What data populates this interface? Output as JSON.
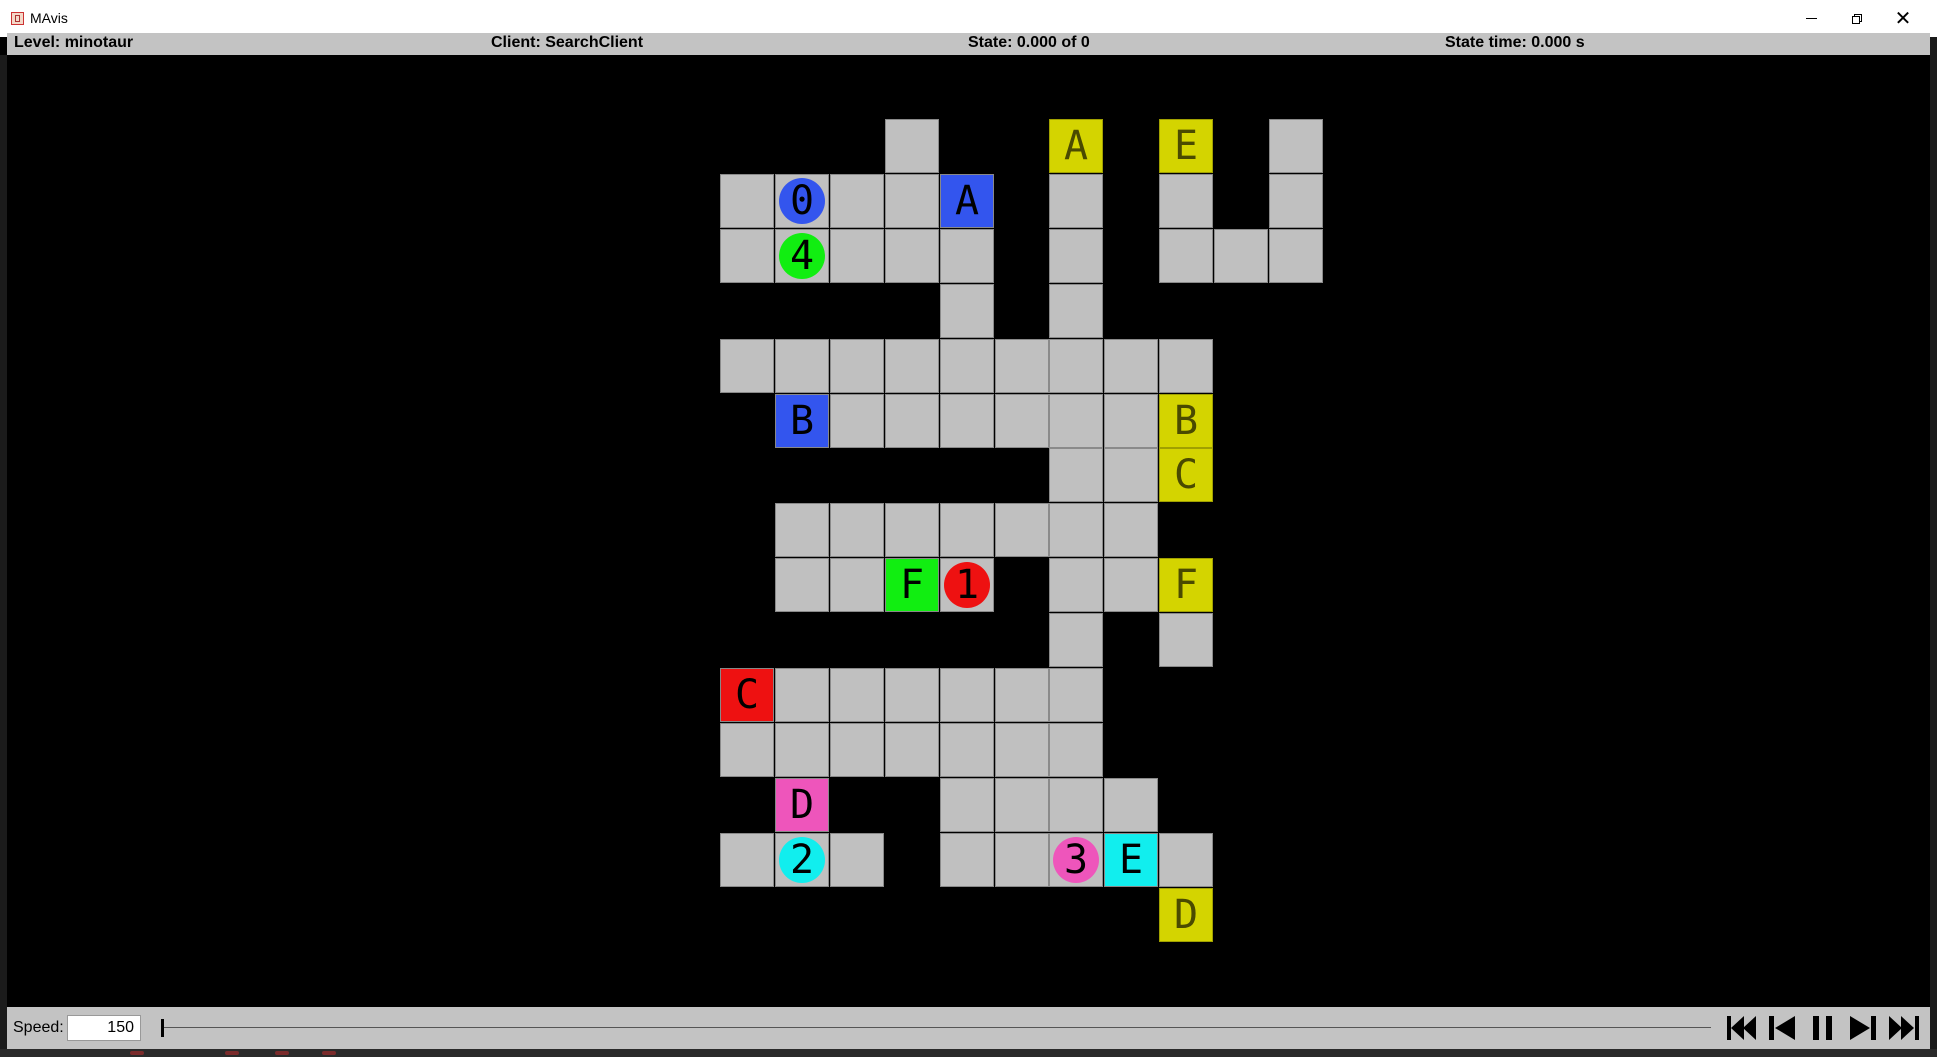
{
  "window": {
    "title": "MAvis",
    "controls": {
      "minimize": "minimize-icon",
      "restore": "restore-icon",
      "close": "✕"
    }
  },
  "status": {
    "level": "Level: minotaur",
    "client": "Client: SearchClient",
    "state": "State: 0.000 of 0",
    "state_time": "State time: 0.000 s"
  },
  "grid": {
    "cells": [
      [
        0,
        3
      ],
      [
        0,
        8
      ],
      [
        0,
        10
      ],
      [
        1,
        0
      ],
      [
        1,
        1
      ],
      [
        1,
        2
      ],
      [
        1,
        3
      ],
      [
        1,
        4
      ],
      [
        1,
        6
      ],
      [
        1,
        8
      ],
      [
        1,
        10
      ],
      [
        2,
        0
      ],
      [
        2,
        1
      ],
      [
        2,
        2
      ],
      [
        2,
        3
      ],
      [
        2,
        4
      ],
      [
        2,
        6
      ],
      [
        2,
        8
      ],
      [
        2,
        9
      ],
      [
        2,
        10
      ],
      [
        3,
        4
      ],
      [
        3,
        6
      ],
      [
        4,
        0
      ],
      [
        4,
        1
      ],
      [
        4,
        2
      ],
      [
        4,
        3
      ],
      [
        4,
        4
      ],
      [
        4,
        5
      ],
      [
        4,
        6
      ],
      [
        4,
        7
      ],
      [
        4,
        8
      ],
      [
        5,
        1
      ],
      [
        5,
        2
      ],
      [
        5,
        3
      ],
      [
        5,
        4
      ],
      [
        5,
        5
      ],
      [
        5,
        6
      ],
      [
        5,
        7
      ],
      [
        5,
        8
      ],
      [
        6,
        6
      ],
      [
        6,
        7
      ],
      [
        6,
        8
      ],
      [
        7,
        1
      ],
      [
        7,
        2
      ],
      [
        7,
        3
      ],
      [
        7,
        4
      ],
      [
        7,
        5
      ],
      [
        7,
        6
      ],
      [
        7,
        7
      ],
      [
        8,
        1
      ],
      [
        8,
        2
      ],
      [
        8,
        3
      ],
      [
        8,
        4
      ],
      [
        8,
        6
      ],
      [
        8,
        7
      ],
      [
        8,
        8
      ],
      [
        9,
        6
      ],
      [
        9,
        8
      ],
      [
        10,
        0
      ],
      [
        10,
        1
      ],
      [
        10,
        2
      ],
      [
        10,
        3
      ],
      [
        10,
        4
      ],
      [
        10,
        5
      ],
      [
        10,
        6
      ],
      [
        11,
        0
      ],
      [
        11,
        1
      ],
      [
        11,
        2
      ],
      [
        11,
        3
      ],
      [
        11,
        4
      ],
      [
        11,
        5
      ],
      [
        11,
        6
      ],
      [
        12,
        1
      ],
      [
        12,
        4
      ],
      [
        12,
        5
      ],
      [
        12,
        6
      ],
      [
        12,
        7
      ],
      [
        13,
        0
      ],
      [
        13,
        1
      ],
      [
        13,
        2
      ],
      [
        13,
        4
      ],
      [
        13,
        5
      ],
      [
        13,
        6
      ],
      [
        13,
        7
      ],
      [
        13,
        8
      ],
      [
        14,
        8
      ]
    ],
    "entities": [
      {
        "kind": "goal",
        "label": "A",
        "row": 0,
        "col": 6,
        "color": "#d4d400"
      },
      {
        "kind": "goal",
        "label": "E",
        "row": 0,
        "col": 8,
        "color": "#d4d400"
      },
      {
        "kind": "agent",
        "label": "0",
        "row": 1,
        "col": 1,
        "color": "#3355ee"
      },
      {
        "kind": "box",
        "label": "A",
        "row": 1,
        "col": 4,
        "color": "#3355ee"
      },
      {
        "kind": "agent",
        "label": "4",
        "row": 2,
        "col": 1,
        "color": "#11ee11"
      },
      {
        "kind": "box",
        "label": "B",
        "row": 5,
        "col": 1,
        "color": "#3355ee"
      },
      {
        "kind": "goal",
        "label": "B",
        "row": 5,
        "col": 8,
        "color": "#d4d400"
      },
      {
        "kind": "goal",
        "label": "C",
        "row": 6,
        "col": 8,
        "color": "#d4d400"
      },
      {
        "kind": "box",
        "label": "F",
        "row": 8,
        "col": 3,
        "color": "#11ee11"
      },
      {
        "kind": "agent",
        "label": "1",
        "row": 8,
        "col": 4,
        "color": "#ee1111"
      },
      {
        "kind": "goal",
        "label": "F",
        "row": 8,
        "col": 8,
        "color": "#d4d400"
      },
      {
        "kind": "box",
        "label": "C",
        "row": 10,
        "col": 0,
        "color": "#ee1111"
      },
      {
        "kind": "box",
        "label": "D",
        "row": 12,
        "col": 1,
        "color": "#ee55bb"
      },
      {
        "kind": "agent",
        "label": "2",
        "row": 13,
        "col": 1,
        "color": "#11eeee"
      },
      {
        "kind": "agent",
        "label": "3",
        "row": 13,
        "col": 6,
        "color": "#ee55bb"
      },
      {
        "kind": "box",
        "label": "E",
        "row": 13,
        "col": 7,
        "color": "#11eeee"
      },
      {
        "kind": "goal",
        "label": "D",
        "row": 14,
        "col": 8,
        "color": "#d4d400"
      }
    ]
  },
  "playback": {
    "speed_label": "Speed:",
    "speed_value": "150",
    "position": 0,
    "buttons": [
      "skip-to-start-icon",
      "step-back-icon",
      "pause-icon",
      "step-forward-icon",
      "skip-to-end-icon"
    ]
  }
}
